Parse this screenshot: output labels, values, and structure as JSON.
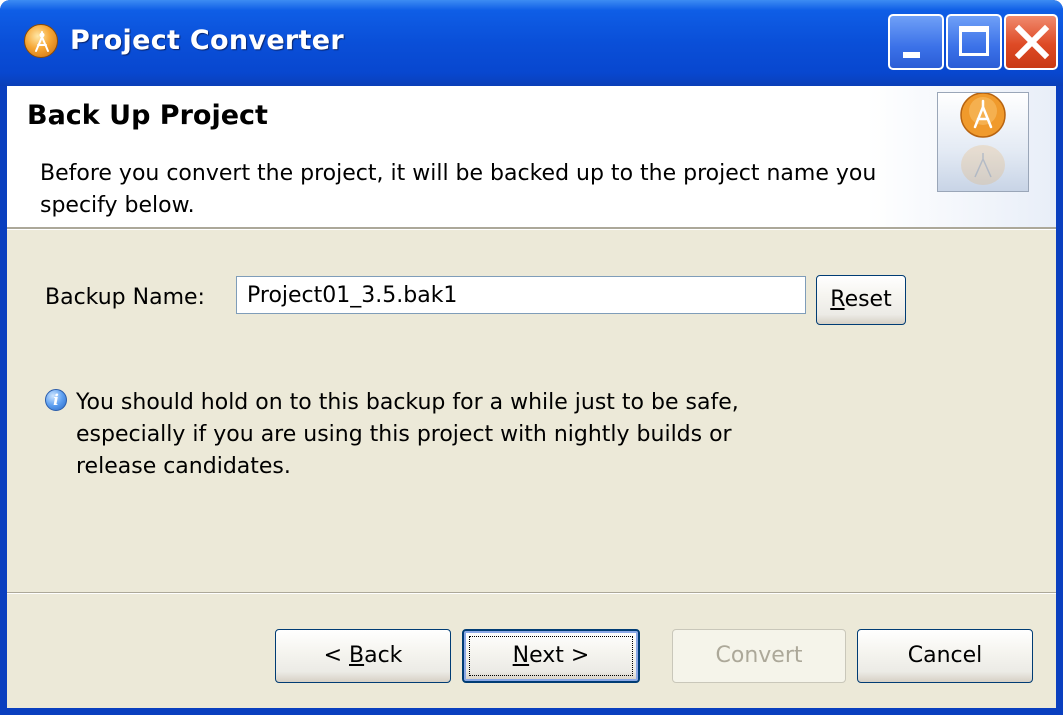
{
  "window": {
    "title": "Project Converter",
    "controls": {
      "minimize": "minimize-icon",
      "maximize": "maximize-icon",
      "close": "close-icon"
    }
  },
  "header": {
    "title": "Back Up Project",
    "description": "Before you convert the project, it will be backed up to the project name you specify below."
  },
  "form": {
    "backup_label": "Backup Name:",
    "backup_value": "Project01_3.5.bak1",
    "reset_button": {
      "mnemonic": "R",
      "rest": "eset"
    }
  },
  "info": {
    "icon": "info-icon",
    "text": "You should hold on to this backup for a while just to be safe, especially if you are using this project with nightly builds or release candidates."
  },
  "buttons": {
    "back": {
      "prefix": "< ",
      "mnemonic": "B",
      "rest": "ack"
    },
    "next": {
      "mnemonic": "N",
      "rest": "ext >"
    },
    "convert": "Convert",
    "cancel": "Cancel"
  },
  "colors": {
    "titlebar": "#0a4fd8",
    "dialog_bg": "#ece9d8",
    "close_button": "#de4a25",
    "disabled_text": "#aca899"
  }
}
